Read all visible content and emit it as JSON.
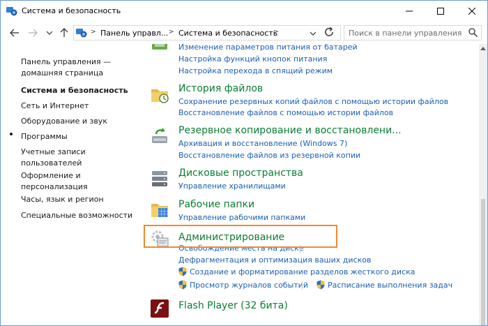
{
  "window": {
    "title": "Система и безопасность"
  },
  "address": {
    "crumbs": [
      "Панель управл...",
      "Система и безопасность"
    ]
  },
  "search": {
    "placeholder": "Поиск в панели управления"
  },
  "sidebar": {
    "home": [
      "Панель управления —",
      "домашняя страница"
    ],
    "items": [
      {
        "label": "Система и безопасность",
        "current": true
      },
      {
        "label": "Сеть и Интернет"
      },
      {
        "label": "Оборудование и звук"
      },
      {
        "label": "Программы"
      },
      {
        "label_lines": [
          "Учетные записи",
          "пользователей"
        ]
      },
      {
        "label_lines": [
          "Оформление и",
          "персонализация"
        ]
      },
      {
        "label": "Часы, язык и регион"
      },
      {
        "label": "Специальные возможности"
      }
    ]
  },
  "categories": {
    "power": {
      "links": [
        "Изменение параметров питания от батарей",
        "Настройка функций кнопок питания",
        "Настройка перехода в спящий режим"
      ]
    },
    "file_history": {
      "title": "История файлов",
      "links": [
        "Сохранение резервных копий файлов с помощью истории файлов",
        "Восстановление файлов с помощью истории файлов"
      ]
    },
    "backup": {
      "title": "Резервное копирование и восстановлени...",
      "links": [
        "Архивация и восстановление (Windows 7)",
        "Восстановление файлов из резервной копии"
      ]
    },
    "storage_spaces": {
      "title": "Дисковые пространства",
      "links": [
        "Управление хранилищами"
      ]
    },
    "work_folders": {
      "title": "Рабочие папки",
      "links": [
        "Управление рабочими папками"
      ]
    },
    "admin": {
      "title": "Администрирование",
      "links": [
        "Освобождение места на диске",
        "Дефрагментация и оптимизация ваших дисков",
        "Создание и форматирование разделов жесткого диска",
        "Просмотр журналов событий",
        "Расписание выполнения задач"
      ]
    },
    "flash": {
      "title": "Flash Player (32 бита)"
    }
  },
  "colors": {
    "category_title": "#0b7d35",
    "link": "#1a5fb4",
    "highlight_border": "#f08a2e"
  }
}
